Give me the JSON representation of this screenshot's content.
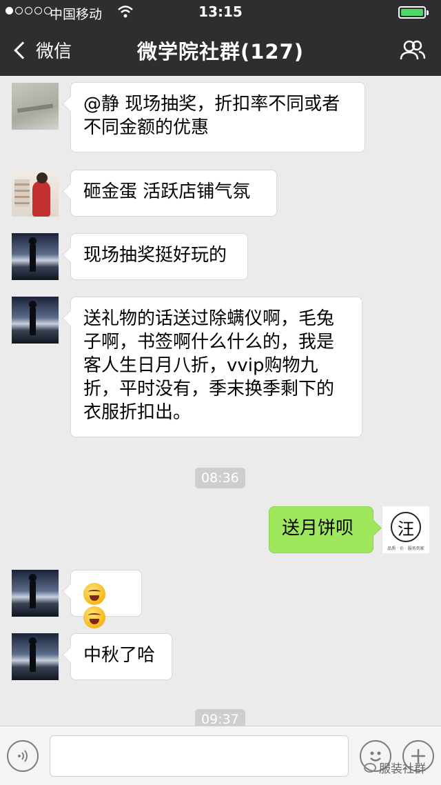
{
  "status": {
    "carrier": "中国移动",
    "time": "13:15"
  },
  "nav": {
    "back_label": "微信",
    "title": "微学院社群(127)"
  },
  "messages": [
    {
      "id": "m1",
      "side": "left",
      "avatar": "wall-photo",
      "lines": [
        "@静 现场抽奖，折扣率不同或者",
        "不同金额的优惠"
      ]
    },
    {
      "id": "m2",
      "side": "left",
      "avatar": "shop-woman-photo",
      "lines": [
        "砸金蛋 活跃店铺气氛"
      ]
    },
    {
      "id": "m3",
      "side": "left",
      "avatar": "night-figure-photo",
      "lines": [
        "现场抽奖挺好玩的"
      ]
    },
    {
      "id": "m4",
      "side": "left",
      "avatar": "night-figure-photo",
      "lines": [
        "送礼物的话送过除螨仪啊，毛兔",
        "子啊，书签啊什么什么的，我是",
        "客人生日月八折，vvip购物九",
        "折，平时没有，季末换季剩下的",
        "衣服折扣出。"
      ]
    },
    {
      "id": "t1",
      "type": "time",
      "text": "08:36"
    },
    {
      "id": "m5",
      "side": "right",
      "avatar": "wang-logo",
      "lines": [
        "送月饼呗"
      ]
    },
    {
      "id": "m6",
      "side": "left",
      "avatar": "night-figure-photo",
      "emoji": [
        "laughing-crying-emoji",
        "laughing-crying-emoji"
      ]
    },
    {
      "id": "m7",
      "side": "left",
      "avatar": "night-figure-photo",
      "lines": [
        "中秋了哈"
      ]
    },
    {
      "id": "t2",
      "type": "time",
      "text": "09:37"
    }
  ],
  "logo_avatar": {
    "glyph": "汪",
    "caption": "品质 · 价 · 服务到家"
  },
  "input": {
    "voice_icon": "voice-icon",
    "emoji_icon": "emoji-icon",
    "plus_icon": "plus-icon"
  },
  "watermark": "服装社群",
  "colors": {
    "nav_bg": "#2e2e31",
    "chat_bg": "#ebebeb",
    "my_bubble": "#9fe75d",
    "battery": "#4cd964"
  }
}
